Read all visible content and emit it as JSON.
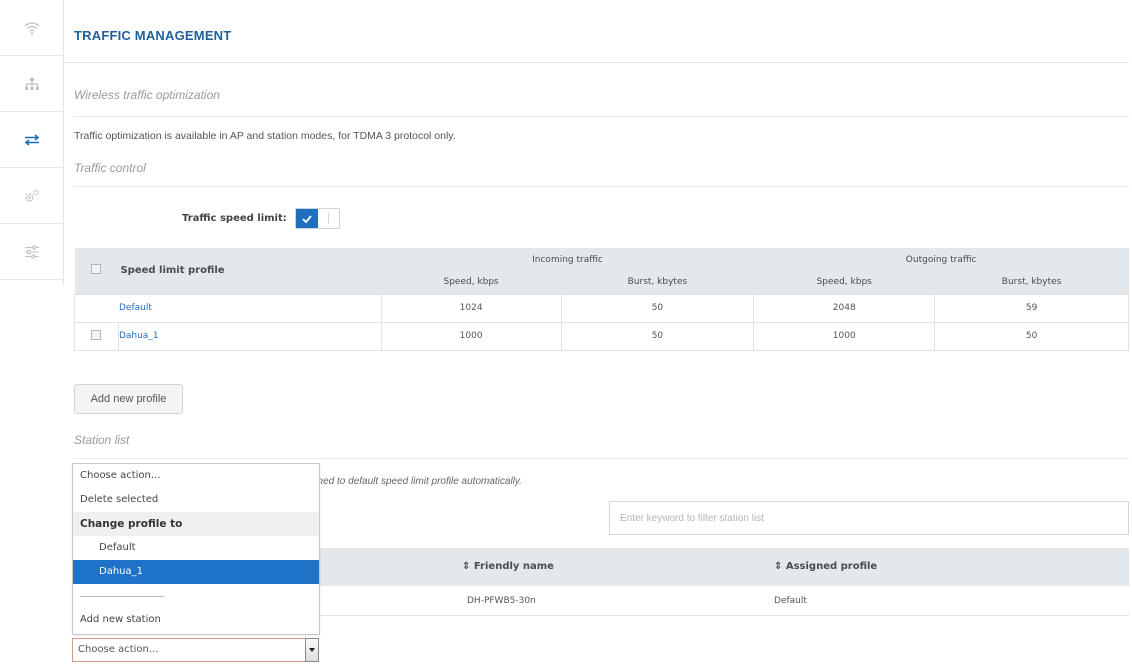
{
  "sidebar": {
    "icons": [
      "wifi-icon",
      "topology-icon",
      "traffic-arrows-icon",
      "settings-gears-icon",
      "sliders-icon"
    ],
    "active_color": "#1f6fbf",
    "inactive_color": "#b9c3cc"
  },
  "page": {
    "title": "TRAFFIC MANAGEMENT",
    "section_wireless": "Wireless traffic optimization",
    "info_text": "Traffic optimization is available in AP and station modes, for TDMA 3 protocol only.",
    "section_traffic_control": "Traffic control",
    "section_station_list": "Station list"
  },
  "speed_limit": {
    "label": "Traffic speed limit:",
    "enabled": true
  },
  "profiles_table": {
    "headers": {
      "profile": "Speed limit profile",
      "incoming": "Incoming traffic",
      "outgoing": "Outgoing traffic",
      "speed": "Speed, kbps",
      "burst": "Burst, kbytes"
    },
    "rows": [
      {
        "name": "Default",
        "in_speed": "1024",
        "in_burst": "50",
        "out_speed": "2048",
        "out_burst": "59"
      },
      {
        "name": "Dahua_1",
        "in_speed": "1000",
        "in_burst": "50",
        "out_speed": "1000",
        "out_burst": "50"
      }
    ]
  },
  "buttons": {
    "add_profile": "Add new profile"
  },
  "station": {
    "partial_info": "gned to default speed limit profile automatically.",
    "filter_placeholder": "Enter keyword to filter station list",
    "columns": {
      "friendly_name": "⇕ Friendly name",
      "assigned_profile": "⇕ Assigned profile"
    },
    "rows": [
      {
        "friendly_name": "DH-PFWB5-30n",
        "assigned_profile": "Default"
      }
    ]
  },
  "action_dropdown": {
    "options": [
      "Choose action...",
      "Delete selected"
    ],
    "group_label": "Change profile to",
    "group_options": [
      "Default",
      "Dahua_1"
    ],
    "selected": "Dahua_1",
    "add_station": "Add new station",
    "current_value": "Choose action..."
  }
}
